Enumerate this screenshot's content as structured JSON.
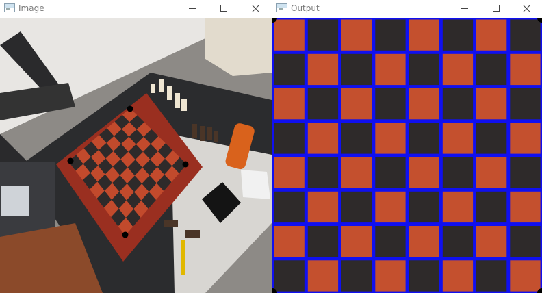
{
  "windows": {
    "image": {
      "title": "Image"
    },
    "output": {
      "title": "Output"
    }
  },
  "icons": {
    "app": "opencv-window-icon",
    "minimize": "minimize-icon",
    "maximize": "maximize-icon",
    "close": "close-icon"
  },
  "board": {
    "rows": 8,
    "cols": 8,
    "colors": {
      "red_square": "#c4502e",
      "dark_square": "#2e2a2a",
      "grid_line": "#1010f0",
      "frame": "#8e2b1e",
      "mat": "#2b2c2e"
    }
  }
}
